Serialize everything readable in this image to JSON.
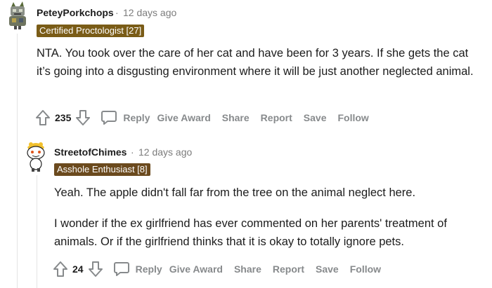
{
  "comments": [
    {
      "username": "PeteyPorkchops",
      "separator": "·",
      "time": "12 days ago",
      "flair": "Certified Proctologist [27]",
      "flair_color": "#7a5c17",
      "paragraphs": [
        "NTA. You took over the care of her cat and have been for 3 years. If she gets the cat it’s going into a disgusting environment where it will be just another neglected animal."
      ],
      "votes": "235",
      "actions": {
        "reply": "Reply",
        "award": "Give Award",
        "share": "Share",
        "report": "Report",
        "save": "Save",
        "follow": "Follow"
      }
    },
    {
      "username": "StreetofChimes",
      "separator": "·",
      "time": "12 days ago",
      "flair": "Asshole Enthusiast [8]",
      "flair_color": "#6b4a1e",
      "paragraphs": [
        "Yeah. The apple didn't fall far from the tree on the animal neglect here.",
        "I wonder if the ex girlfriend has ever commented on her parents' treatment of animals. Or if the girlfriend thinks that it is okay to totally ignore pets."
      ],
      "votes": "24",
      "actions": {
        "reply": "Reply",
        "award": "Give Award",
        "share": "Share",
        "report": "Report",
        "save": "Save",
        "follow": "Follow"
      }
    }
  ],
  "icons": {
    "upvote": "upvote-arrow-icon",
    "downvote": "downvote-arrow-icon",
    "reply": "speech-bubble-icon"
  }
}
